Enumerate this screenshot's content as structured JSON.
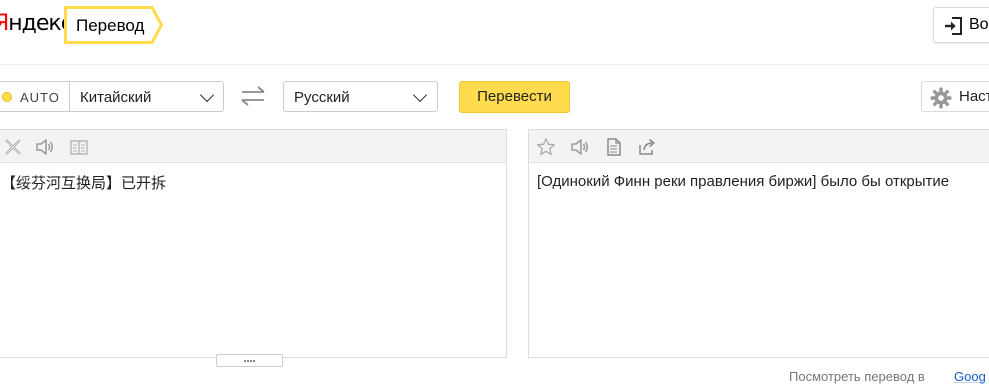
{
  "header": {
    "logo_red": "Я",
    "logo_text": "ндекс",
    "service_title": "Перевод",
    "login_label": "Во",
    "login_icon": "login-door-icon"
  },
  "toolbar": {
    "auto_label": "AUTO",
    "source_language": "Китайский",
    "swap_icon": "swap-arrows-icon",
    "target_language": "Русский",
    "translate_label": "Перевести",
    "settings_label": "Наст",
    "settings_icon": "gear-icon"
  },
  "source_pane": {
    "text": "【绥芬河互换局】已开拆",
    "tools": [
      "clear-icon",
      "listen-icon",
      "dictionary-icon"
    ]
  },
  "target_pane": {
    "text": "[Одинокий Финн реки правления биржи] было бы открытие",
    "tools": [
      "star-icon",
      "listen-icon",
      "copy-icon",
      "share-icon"
    ]
  },
  "footer": {
    "view_in_text": "Посмотреть перевод в",
    "view_in_link": "Goog"
  },
  "colors": {
    "accent_yellow": "#ffdb4d",
    "logo_red": "#ff0000",
    "toolbar_gray": "#f3f3f3",
    "link_blue": "#1a5ec8"
  }
}
